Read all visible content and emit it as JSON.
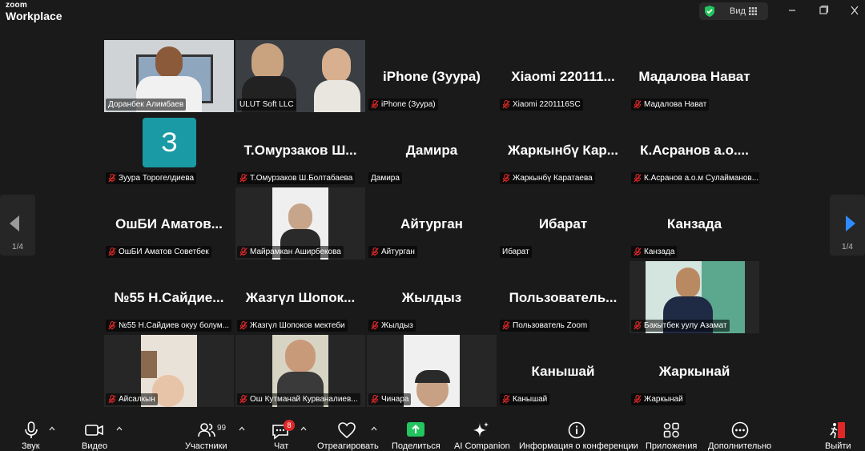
{
  "titlebar": {
    "brand_top": "zoom",
    "brand_bottom": "Workplace",
    "view_label": "Вид"
  },
  "gallery": {
    "page_left": "1/4",
    "page_right": "1/4",
    "tiles": [
      {
        "name": "Доранбек Алимбаев",
        "display": "",
        "muted": false,
        "kind": "video",
        "active": true
      },
      {
        "name": "ULUT Soft LLC",
        "display": "",
        "muted": false,
        "kind": "video"
      },
      {
        "name": "iPhone (Зуура)",
        "display": "iPhone (Зуура)",
        "muted": true,
        "kind": "name"
      },
      {
        "name": "Xiaomi 2201116SC",
        "display": "Xiaomi 220111...",
        "muted": true,
        "kind": "name"
      },
      {
        "name": "Мадалова Нават",
        "display": "Мадалова Нават",
        "muted": true,
        "kind": "name"
      },
      {
        "name": "Зуура Торогелдиева",
        "display": "З",
        "muted": true,
        "kind": "avatar"
      },
      {
        "name": "Т.Омурзаков Ш.Болтабаева",
        "display": "Т.Омурзаков Ш...",
        "muted": true,
        "kind": "name"
      },
      {
        "name": "Дамира",
        "display": "Дамира",
        "muted": false,
        "kind": "name"
      },
      {
        "name": "Жаркынбү Каратаева",
        "display": "Жаркынбү Кар...",
        "muted": true,
        "kind": "name"
      },
      {
        "name": "К.Асранов а.о.м Сулайманов...",
        "display": "К.Асранов а.о....",
        "muted": true,
        "kind": "name"
      },
      {
        "name": "ОшБИ Аматов Советбек",
        "display": "ОшБИ Аматов...",
        "muted": true,
        "kind": "name"
      },
      {
        "name": "Майрамкан Аширбекова",
        "display": "",
        "muted": true,
        "kind": "video"
      },
      {
        "name": "Айтурган",
        "display": "Айтурган",
        "muted": true,
        "kind": "name"
      },
      {
        "name": "Ибарат",
        "display": "Ибарат",
        "muted": false,
        "kind": "name"
      },
      {
        "name": "Канзада",
        "display": "Канзада",
        "muted": true,
        "kind": "name"
      },
      {
        "name": "№55 Н.Сайдиев окуу болум...",
        "display": "№55 Н.Сайдие...",
        "muted": true,
        "kind": "name"
      },
      {
        "name": "Жазгүл Шопоков мектеби",
        "display": "Жазгүл Шопок...",
        "muted": true,
        "kind": "name"
      },
      {
        "name": "Жылдыз",
        "display": "Жылдыз",
        "muted": true,
        "kind": "name"
      },
      {
        "name": "Пользователь Zoom",
        "display": "Пользователь...",
        "muted": true,
        "kind": "name"
      },
      {
        "name": "Бакытбек уулу Азамат",
        "display": "",
        "muted": true,
        "kind": "video"
      },
      {
        "name": "Айсалкын",
        "display": "",
        "muted": true,
        "kind": "video"
      },
      {
        "name": "Ош Кутманай Курваналиев...",
        "display": "",
        "muted": true,
        "kind": "video"
      },
      {
        "name": "Чинара",
        "display": "",
        "muted": true,
        "kind": "video"
      },
      {
        "name": "Канышай",
        "display": "Канышай",
        "muted": true,
        "kind": "name"
      },
      {
        "name": "Жаркынай",
        "display": "Жаркынай",
        "muted": true,
        "kind": "name"
      }
    ]
  },
  "toolbar": {
    "audio": "Звук",
    "video": "Видео",
    "participants": "Участники",
    "participants_count": "99",
    "chat": "Чат",
    "chat_badge": "8",
    "react": "Отреагировать",
    "share": "Поделиться",
    "ai": "AI Companion",
    "info": "Информация о конференции",
    "apps": "Приложения",
    "more": "Дополнительно",
    "leave": "Выйти"
  },
  "colors": {
    "active_border": "#3ddc84",
    "muted_icon": "#e02828",
    "share_green": "#23c55e",
    "avatar_teal": "#1a9aa4",
    "nav_arrow": "#2d8cff"
  }
}
